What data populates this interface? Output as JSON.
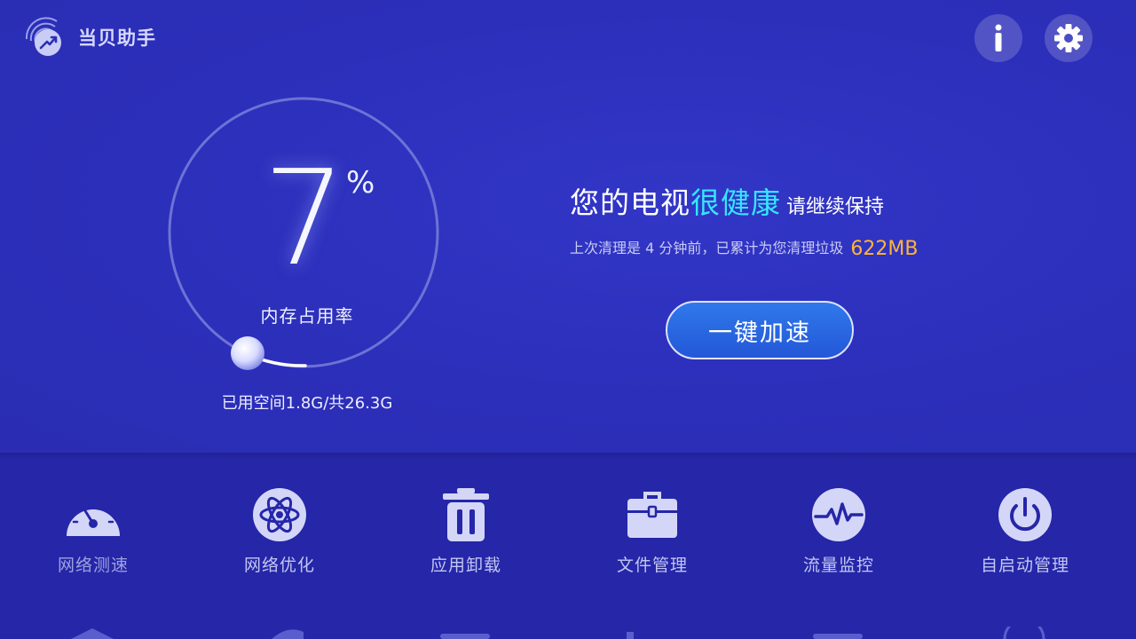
{
  "app": {
    "name": "当贝助手"
  },
  "header": {
    "info_icon": "info-icon",
    "settings_icon": "gear-icon"
  },
  "memory": {
    "percent": "7",
    "percent_sign": "%",
    "label": "内存占用率",
    "storage": "已用空间1.8G/共26.3G"
  },
  "status": {
    "prefix": "您的电视",
    "highlight": "很健康",
    "suffix": "请继续保持",
    "sub": "上次清理是 4 分钟前，已累计为您清理垃圾",
    "cleaned": "622MB"
  },
  "boost_button": {
    "label": "一键加速"
  },
  "tools": [
    {
      "label": "网络测速",
      "icon": "speedometer-icon"
    },
    {
      "label": "网络优化",
      "icon": "atom-icon"
    },
    {
      "label": "应用卸载",
      "icon": "trash-icon"
    },
    {
      "label": "文件管理",
      "icon": "briefcase-icon"
    },
    {
      "label": "流量监控",
      "icon": "pulse-icon"
    },
    {
      "label": "自启动管理",
      "icon": "power-icon"
    }
  ],
  "colors": {
    "background": "#2b2fb8",
    "accent_text": "#35e6ff",
    "cleaned_text": "#ffb534",
    "button_blue": "#2a66e0"
  }
}
